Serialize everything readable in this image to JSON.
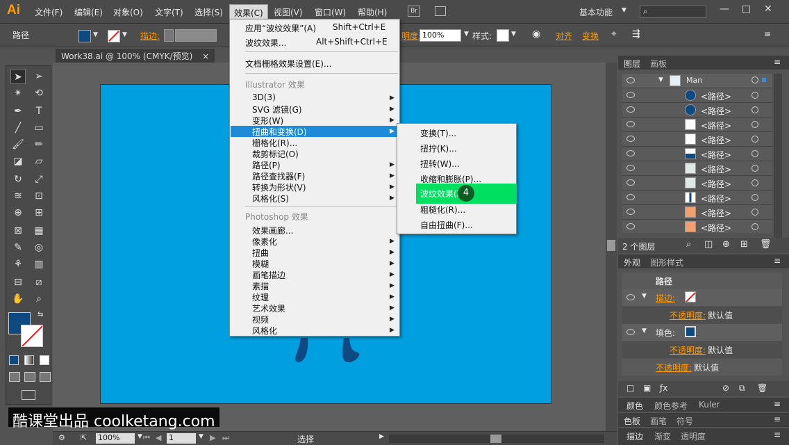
{
  "app": {
    "logo": "Ai"
  },
  "menubar": {
    "items": [
      "文件(F)",
      "编辑(E)",
      "对象(O)",
      "文字(T)",
      "选择(S)",
      "效果(C)",
      "视图(V)",
      "窗口(W)",
      "帮助(H)"
    ],
    "br": "Br",
    "workspace": "基本功能",
    "window_controls": [
      "—",
      "□",
      "✕"
    ]
  },
  "control_bar": {
    "mode_label": "路径",
    "stroke_label": "描边:",
    "opacity_label_partial": "明度:",
    "opacity_value": "100%",
    "style_label": "样式:",
    "align_label": "对齐",
    "transform_label": "变换"
  },
  "document_tab": {
    "title": "Work38.ai @ 100% (CMYK/预览)",
    "close": "×"
  },
  "effect_menu": {
    "items": [
      {
        "label": "应用“波纹效果”(A)",
        "shortcut": "Shift+Ctrl+E"
      },
      {
        "label": "波纹效果...",
        "shortcut": "Alt+Shift+Ctrl+E"
      },
      {
        "label": "文档栅格效果设置(E)..."
      }
    ],
    "illustrator_header": "Illustrator 效果",
    "illustrator_items": [
      "3D(3)",
      "SVG 滤镜(G)",
      "变形(W)",
      "扭曲和变换(D)",
      "栅格化(R)...",
      "裁剪标记(O)",
      "路径(P)",
      "路径查找器(F)",
      "转换为形状(V)",
      "风格化(S)"
    ],
    "photoshop_header": "Photoshop 效果",
    "photoshop_items": [
      "效果画廊...",
      "像素化",
      "扭曲",
      "模糊",
      "画笔描边",
      "素描",
      "纹理",
      "艺术效果",
      "视频",
      "风格化"
    ]
  },
  "submenu": {
    "items": [
      "变换(T)...",
      "扭拧(K)...",
      "扭转(W)...",
      "收缩和膨胀(P)...",
      "波纹效果(Z)...",
      "粗糙化(R)...",
      "自由扭曲(F)..."
    ],
    "badge": "4"
  },
  "layers_panel": {
    "tabs": [
      "图层",
      "画板"
    ],
    "layer_name": "Man",
    "path_label": "<路径>",
    "footer": "2 个图层"
  },
  "appearance_panel": {
    "tabs": [
      "外观",
      "图形样式"
    ],
    "title": "路径",
    "stroke_label": "描边:",
    "fill_label": "填色:",
    "opacity_label": "不透明度:",
    "default_value": "默认值"
  },
  "bottom_panels": {
    "row1": [
      "颜色",
      "颜色参考",
      "Kuler"
    ],
    "row2": [
      "色板",
      "画笔",
      "符号"
    ],
    "row3": [
      "描边",
      "渐变",
      "透明度"
    ]
  },
  "status": {
    "zoom": "100%",
    "page": "1",
    "tool": "选择"
  },
  "watermark": "酷课堂出品 coolketang.com",
  "colors": {
    "artboard": "#00a0e0",
    "highlight_green": "#00e060",
    "menu_highlight": "#1e8bd8",
    "figure": "#0d4a82",
    "fill_swatch": "#0d4a82"
  }
}
